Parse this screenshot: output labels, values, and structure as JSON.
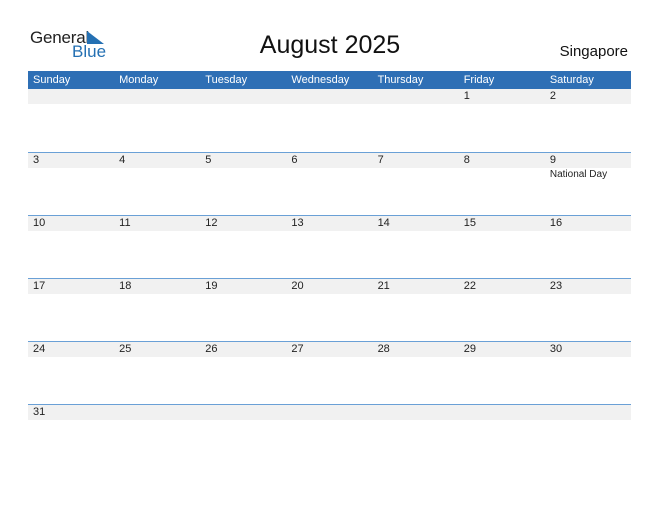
{
  "logo": {
    "word1": "General",
    "word2": "Blue",
    "icon": "triangle-flag-icon",
    "brand_color": "#2470b3"
  },
  "title": "August 2025",
  "country": "Singapore",
  "header_color": "#2e6fb5",
  "weekdays": [
    "Sunday",
    "Monday",
    "Tuesday",
    "Wednesday",
    "Thursday",
    "Friday",
    "Saturday"
  ],
  "weeks": [
    {
      "days": [
        {
          "num": "",
          "event": ""
        },
        {
          "num": "",
          "event": ""
        },
        {
          "num": "",
          "event": ""
        },
        {
          "num": "",
          "event": ""
        },
        {
          "num": "",
          "event": ""
        },
        {
          "num": "1",
          "event": ""
        },
        {
          "num": "2",
          "event": ""
        }
      ]
    },
    {
      "days": [
        {
          "num": "3",
          "event": ""
        },
        {
          "num": "4",
          "event": ""
        },
        {
          "num": "5",
          "event": ""
        },
        {
          "num": "6",
          "event": ""
        },
        {
          "num": "7",
          "event": ""
        },
        {
          "num": "8",
          "event": ""
        },
        {
          "num": "9",
          "event": "National Day"
        }
      ]
    },
    {
      "days": [
        {
          "num": "10",
          "event": ""
        },
        {
          "num": "11",
          "event": ""
        },
        {
          "num": "12",
          "event": ""
        },
        {
          "num": "13",
          "event": ""
        },
        {
          "num": "14",
          "event": ""
        },
        {
          "num": "15",
          "event": ""
        },
        {
          "num": "16",
          "event": ""
        }
      ]
    },
    {
      "days": [
        {
          "num": "17",
          "event": ""
        },
        {
          "num": "18",
          "event": ""
        },
        {
          "num": "19",
          "event": ""
        },
        {
          "num": "20",
          "event": ""
        },
        {
          "num": "21",
          "event": ""
        },
        {
          "num": "22",
          "event": ""
        },
        {
          "num": "23",
          "event": ""
        }
      ]
    },
    {
      "days": [
        {
          "num": "24",
          "event": ""
        },
        {
          "num": "25",
          "event": ""
        },
        {
          "num": "26",
          "event": ""
        },
        {
          "num": "27",
          "event": ""
        },
        {
          "num": "28",
          "event": ""
        },
        {
          "num": "29",
          "event": ""
        },
        {
          "num": "30",
          "event": ""
        }
      ]
    },
    {
      "days": [
        {
          "num": "31",
          "event": ""
        },
        {
          "num": "",
          "event": ""
        },
        {
          "num": "",
          "event": ""
        },
        {
          "num": "",
          "event": ""
        },
        {
          "num": "",
          "event": ""
        },
        {
          "num": "",
          "event": ""
        },
        {
          "num": "",
          "event": ""
        }
      ]
    }
  ]
}
